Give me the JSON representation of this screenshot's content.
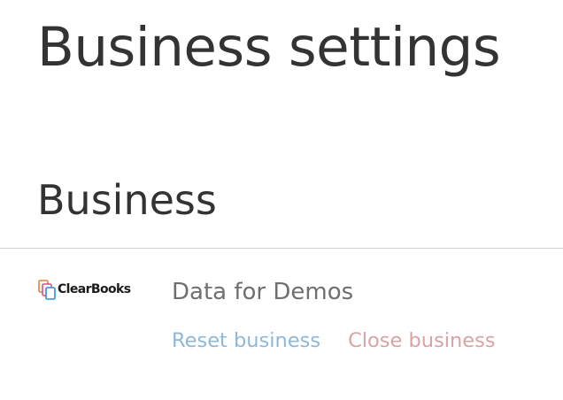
{
  "header": {
    "title": "Business settings"
  },
  "section": {
    "title": "Business"
  },
  "business": {
    "logo_text": "ClearBooks",
    "logo_icon": "clearbooks-logo-icon",
    "name": "Data for Demos",
    "actions": {
      "reset_label": "Reset business",
      "close_label": "Close business"
    }
  },
  "colors": {
    "text": "#333333",
    "muted_text": "#6f6f6f",
    "reset_link": "#8fb8d8",
    "close_link": "#d9a3a3",
    "divider": "#cfcfcf"
  }
}
